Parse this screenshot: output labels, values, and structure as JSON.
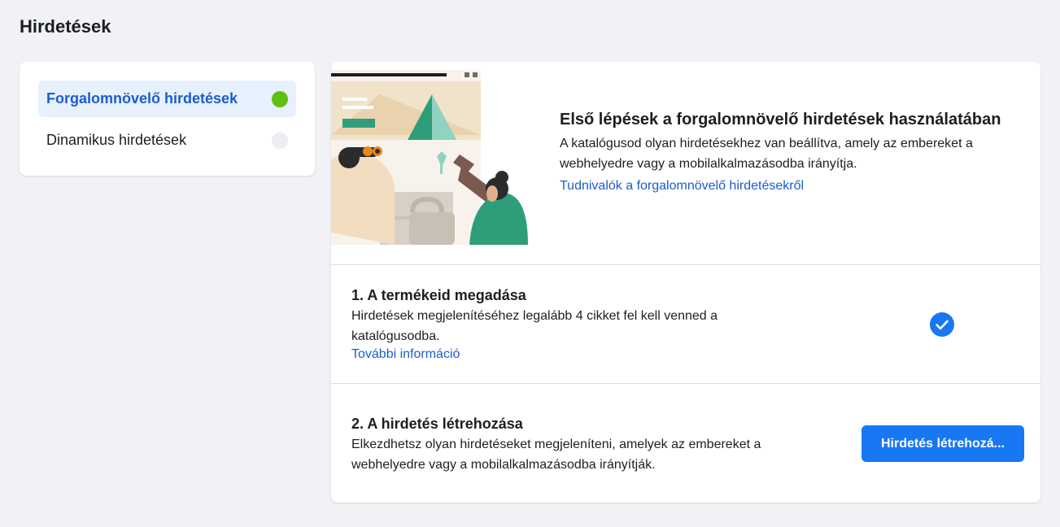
{
  "page": {
    "title": "Hirdetések"
  },
  "sidebar": {
    "items": [
      {
        "label": "Forgalomnövelő hirdetések",
        "active": true,
        "status_color": "#5fc012"
      },
      {
        "label": "Dinamikus hirdetések",
        "active": false,
        "status_color": "#eceef1"
      }
    ]
  },
  "hero": {
    "title": "Első lépések a forgalomnövelő hirdetések használatában",
    "description": "A katalógusod olyan hirdetésekhez van beállítva, amely az embereket a webhelyedre vagy a mobilalkalmazásodba irányítja.",
    "link": "Tudnivalók a forgalomnövelő hirdetésekről"
  },
  "steps": [
    {
      "title": "1. A termékeid megadása",
      "description": "Hirdetések megjelenítéséhez legalább 4 cikket fel kell venned a katalógusodba.",
      "link": "További információ",
      "status_icon": "check-circle-icon"
    },
    {
      "title": "2. A hirdetés létrehozása",
      "description": "Elkezdhetsz olyan hirdetéseket megjeleníteni, amelyek az embereket a webhelyedre vagy a mobilalkalmazásodba irányítják.",
      "button": "Hirdetés létrehozá..."
    }
  ],
  "colors": {
    "accent": "#1877f2",
    "link": "#1d5dc9",
    "active_bg": "#e7f0fd",
    "success": "#5fc012"
  }
}
